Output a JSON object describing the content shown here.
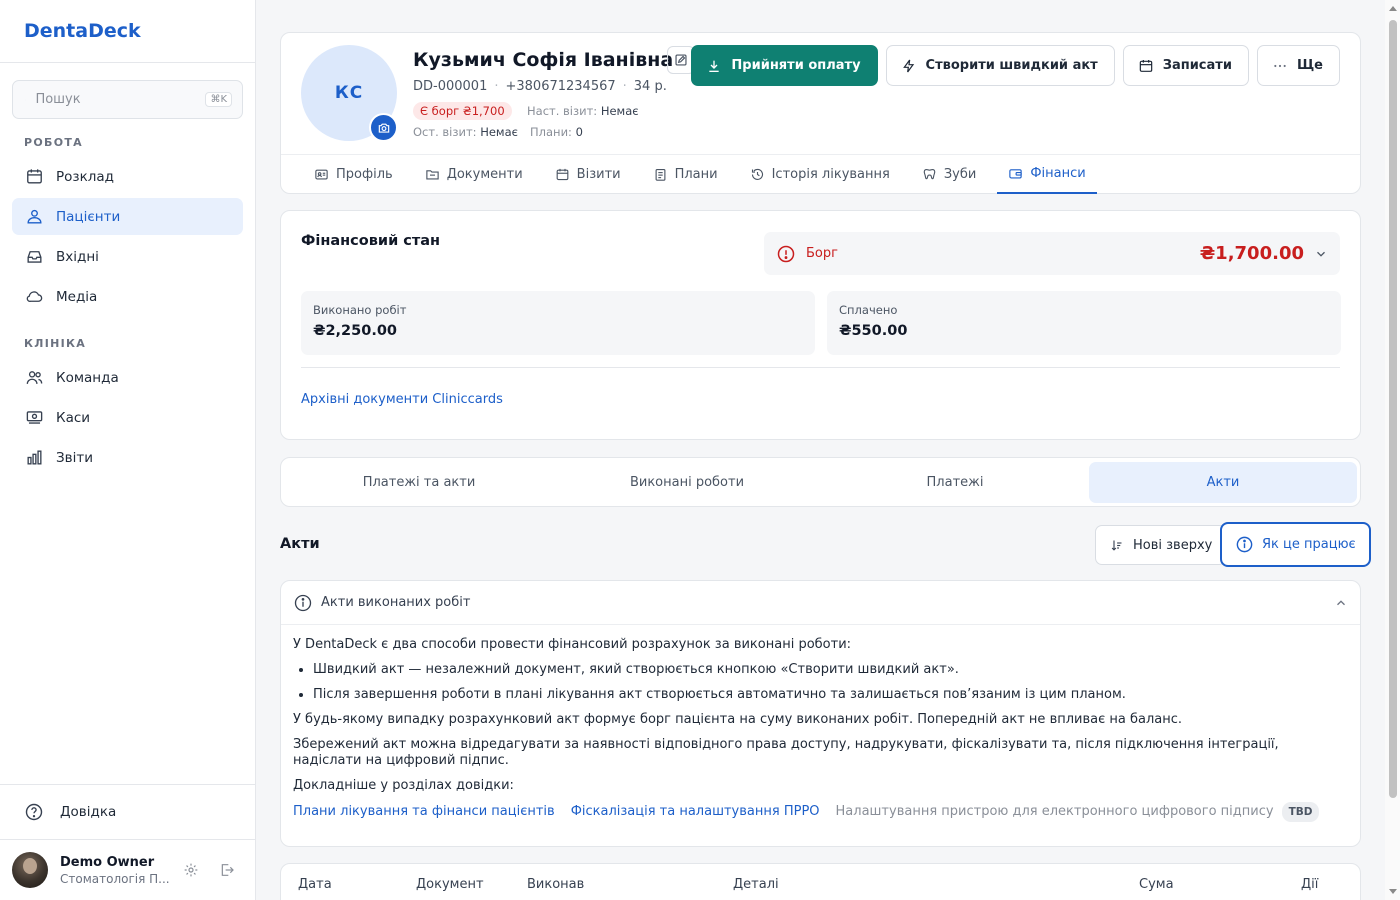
{
  "brand": "DentaDeck",
  "search": {
    "placeholder": "Пошук",
    "shortcut": "⌘K"
  },
  "sidebar": {
    "section_work": "РОБОТА",
    "section_clinic": "КЛІНІКА",
    "work_items": [
      {
        "label": "Розклад",
        "icon": "calendar-icon"
      },
      {
        "label": "Пацієнти",
        "icon": "users-icon"
      },
      {
        "label": "Вхідні",
        "icon": "inbox-icon"
      },
      {
        "label": "Медіа",
        "icon": "cloud-icon"
      }
    ],
    "clinic_items": [
      {
        "label": "Команда",
        "icon": "team-icon"
      },
      {
        "label": "Каси",
        "icon": "cash-register-icon"
      },
      {
        "label": "Звіти",
        "icon": "bar-chart-icon"
      }
    ],
    "help": "Довідка",
    "user": {
      "name": "Demo Owner",
      "clinic": "Стоматологія П..."
    }
  },
  "patient": {
    "initials": "КС",
    "name": "Кузьмич Софія Іванівна",
    "id": "DD-000001",
    "phone": "+380671234567",
    "age": "34 р.",
    "debt_badge": "Є борг ₴1,700",
    "next_visit_label": "Наст. візит:",
    "next_visit_value": "Немає",
    "last_visit_label": "Ост. візит:",
    "last_visit_value": "Немає",
    "plans_label": "Плани:",
    "plans_value": "0"
  },
  "actions": {
    "accept_payment": "Прийняти оплату",
    "quick_act": "Створити швидкий акт",
    "schedule": "Записати",
    "more": "Ще"
  },
  "tabs": [
    "Профіль",
    "Документи",
    "Візити",
    "Плани",
    "Історія лікування",
    "Зуби",
    "Фінанси"
  ],
  "finance": {
    "title": "Фінансовий стан",
    "debt_label": "Борг",
    "debt_amount": "₴1,700.00",
    "done_label": "Виконано робіт",
    "done_value": "₴2,250.00",
    "paid_label": "Сплачено",
    "paid_value": "₴550.00",
    "archive_link": "Архівні документи Cliniccards"
  },
  "subtabs": [
    "Платежі та акти",
    "Виконані роботи",
    "Платежі",
    "Акти"
  ],
  "acts": {
    "title": "Акти",
    "sort": "Нові зверху",
    "how": "Як це працює"
  },
  "info": {
    "header": "Акти виконаних робіт",
    "intro": "У DentaDeck є два способи провести фінансовий розрахунок за виконані роботи:",
    "bullet1": "Швидкий акт — незалежний документ, який створюється кнопкою «Створити швидкий акт».",
    "bullet2": "Після завершення роботи в плані лікування акт створюється автоматично та залишається пов’язаним із цим планом.",
    "para1": "У будь-якому випадку розрахунковий акт формує борг пацієнта на суму виконаних робіт. Попередній акт не впливає на баланс.",
    "para2": "Збережений акт можна відредагувати за наявності відповідного права доступу, надрукувати, фіскалізувати та, після підключення інтеграції, надіслати на цифровий підпис.",
    "more": "Докладніше у розділах довідки:",
    "link1": "Плани лікування та фінанси пацієнтів",
    "link2": "Фіскалізація та налаштування ПРРО",
    "link3": "Налаштування пристрою для електронного цифрового підпису",
    "tbd": "TBD"
  },
  "table": {
    "headers": [
      "Дата",
      "Документ",
      "Виконав",
      "Деталі",
      "Сума",
      "Дії"
    ]
  },
  "colors": {
    "accent": "#1d5fc9",
    "primary_button": "#0f8072",
    "debt": "#c81e1e"
  }
}
